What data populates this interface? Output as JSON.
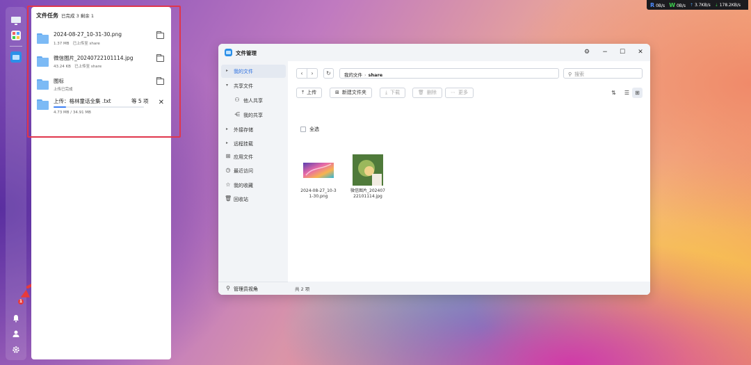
{
  "netstats": {
    "read_label": "R",
    "read_speed": "0B/s",
    "write_label": "W",
    "write_speed": "0B/s",
    "upload": "3.7KB/s",
    "download": "178.2KB/s"
  },
  "task_panel": {
    "title": "文件任务",
    "summary": "已完成 3 剩余 1",
    "items": [
      {
        "name": "2024-08-27_10-31-30.png",
        "size": "1.37 MB",
        "status": "已上传至 share"
      },
      {
        "name": "微信图片_20240722101114.jpg",
        "size": "43.24 KB",
        "status": "已上传至 share"
      },
      {
        "name": "图标",
        "status": "上传已完成"
      },
      {
        "name": "上传：格林童话全集 .txt",
        "count": "等 5 项",
        "progress_text": "4.73 MB / 34.91 MB",
        "progress": 0.14
      }
    ]
  },
  "dock": {
    "badge_count": "1"
  },
  "file_manager": {
    "title": "文件管理",
    "sidebar": {
      "items": [
        {
          "label": "我的文件"
        },
        {
          "label": "共享文件"
        },
        {
          "label": "他人共享"
        },
        {
          "label": "我的共享"
        },
        {
          "label": "外接存储"
        },
        {
          "label": "远程挂载"
        },
        {
          "label": "应用文件"
        },
        {
          "label": "最近访问"
        },
        {
          "label": "我的收藏"
        },
        {
          "label": "回收站"
        }
      ],
      "bottom": "管理员视角"
    },
    "path": {
      "root": "我的文件",
      "current": "share"
    },
    "search_placeholder": "搜索",
    "toolbar": {
      "upload": "上传",
      "new_folder": "新建文件夹",
      "download": "下载",
      "delete": "删除",
      "more": "更多"
    },
    "select_all": "全选",
    "files": [
      {
        "name": "2024-08-27_10-31-30.png"
      },
      {
        "name": "微信图片_20240722101114.jpg"
      }
    ],
    "status": "共 2 项"
  }
}
